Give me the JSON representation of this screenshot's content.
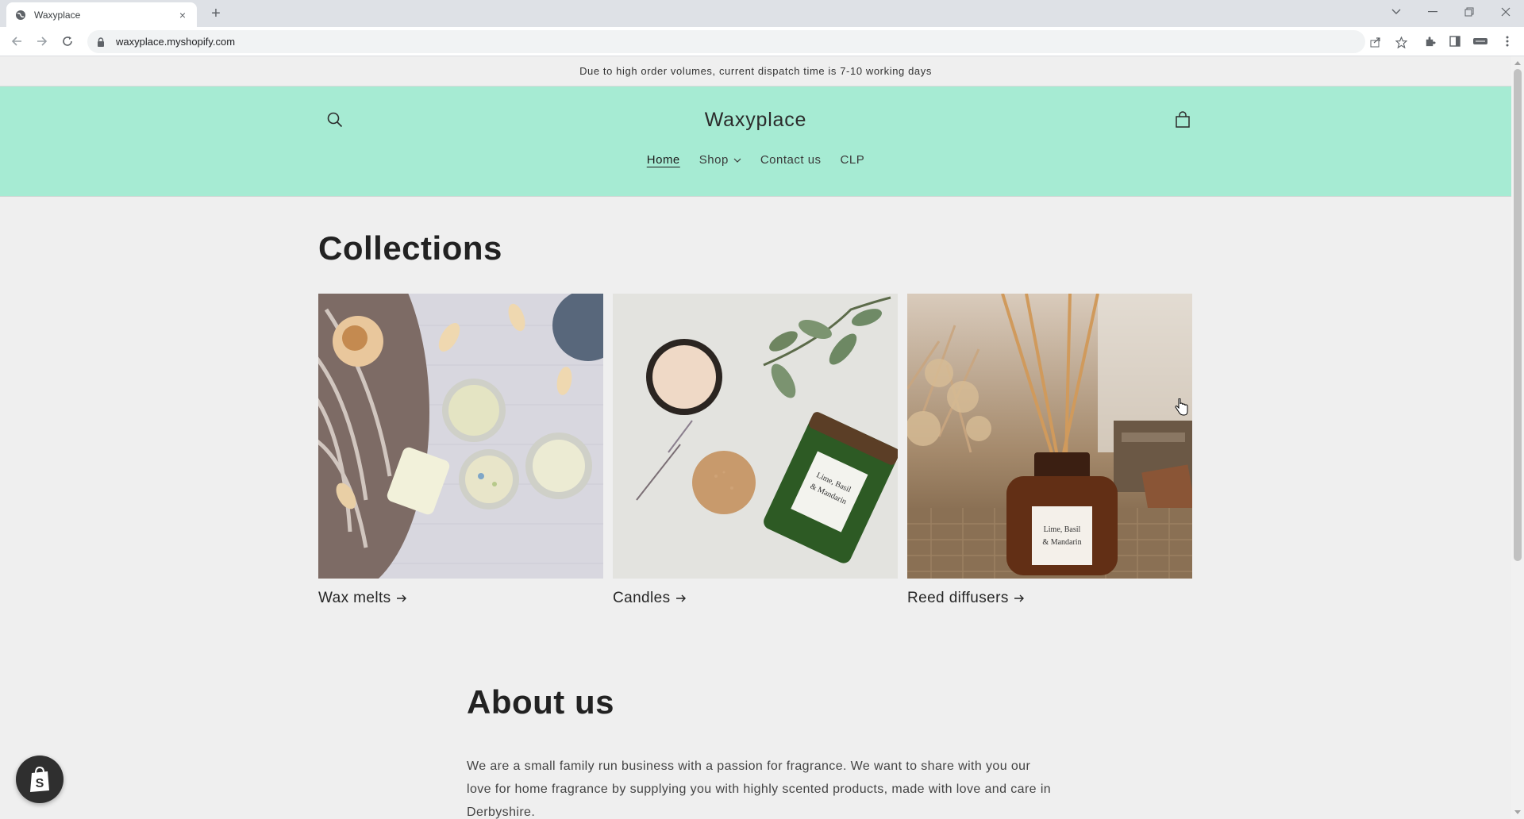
{
  "browser": {
    "tab_title": "Waxyplace",
    "tab_close": "×",
    "new_tab": "+",
    "url": "waxyplace.myshopify.com"
  },
  "announcement": "Due to high order volumes, current dispatch time is 7-10 working days",
  "header": {
    "brand": "Waxyplace",
    "bg_color": "#a6ebd3",
    "nav": [
      {
        "label": "Home",
        "active": true
      },
      {
        "label": "Shop",
        "has_dropdown": true
      },
      {
        "label": "Contact us"
      },
      {
        "label": "CLP"
      }
    ]
  },
  "collections": {
    "title": "Collections",
    "items": [
      {
        "label": "Wax melts",
        "icon": "arrow-right-icon"
      },
      {
        "label": "Candles",
        "icon": "arrow-right-icon"
      },
      {
        "label": "Reed diffusers",
        "icon": "arrow-right-icon"
      }
    ]
  },
  "about": {
    "title": "About us",
    "text": "We are a small family run business with a passion for fragrance. We want to share with you our love for home fragrance by supplying you with highly scented products, made with love and care in Derbyshire."
  }
}
